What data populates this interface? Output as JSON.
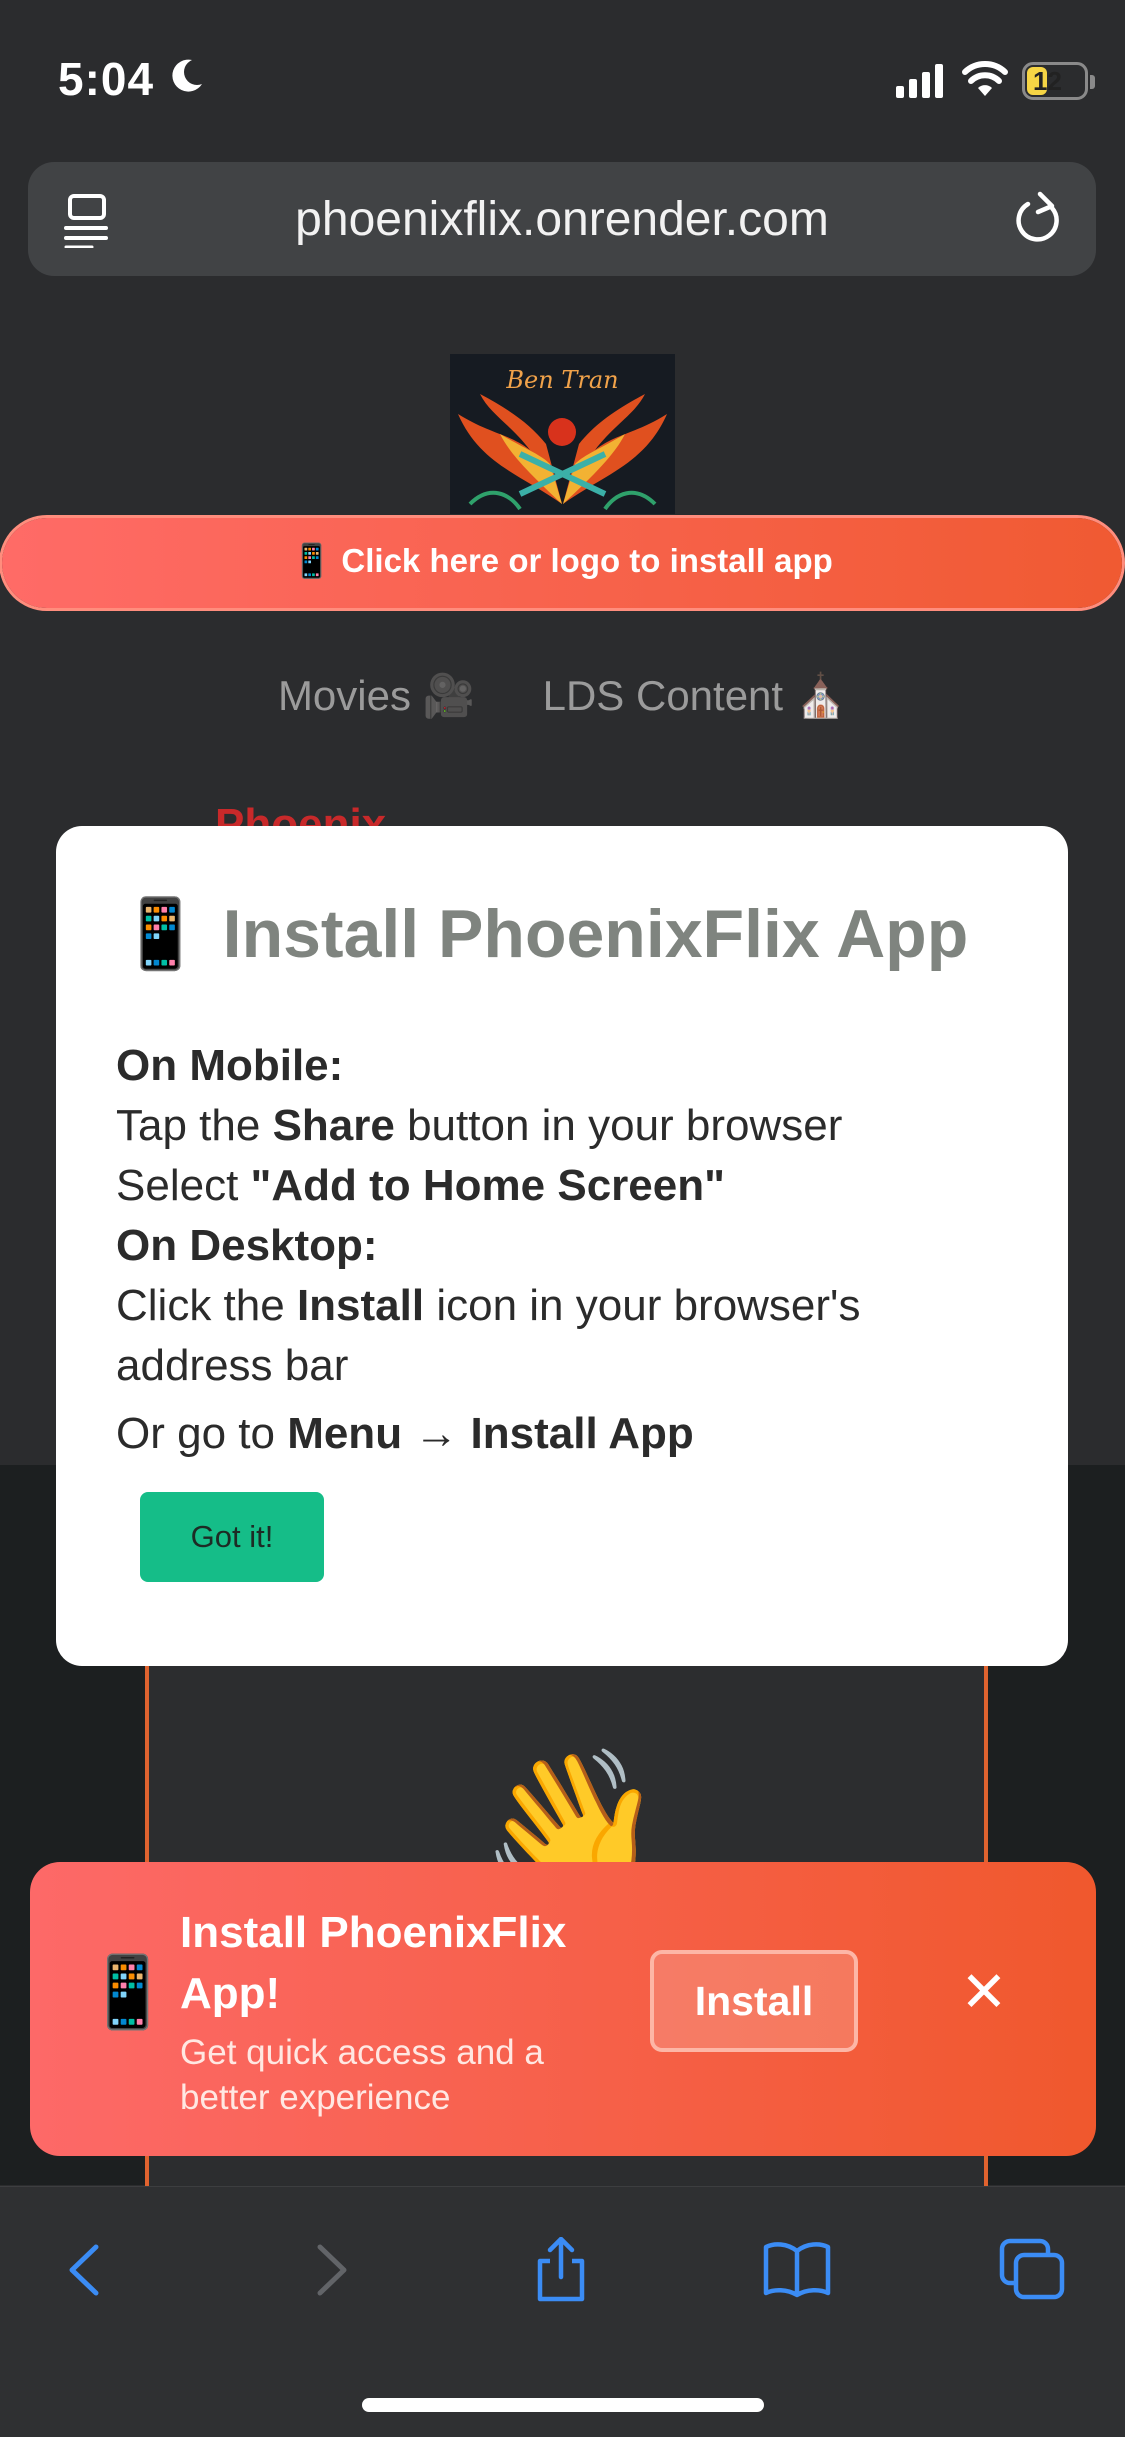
{
  "status_bar": {
    "time": "5:04",
    "battery": "12"
  },
  "browser": {
    "url": "phoenixflix.onrender.com"
  },
  "page": {
    "logo_text": "Ben Tran",
    "install_banner": "📱 Click here or logo to install app",
    "nav": {
      "movies": "Movies 🎥",
      "lds": "LDS Content ⛪"
    },
    "partial_title": "Phoenix",
    "wave_emoji": "👋"
  },
  "modal": {
    "emoji": "📱",
    "title": "Install PhoenixFlix App",
    "mobile_heading": "On Mobile:",
    "mobile_line1_pre": "Tap the ",
    "mobile_line1_bold": "Share",
    "mobile_line1_post": " button in your browser",
    "mobile_line2_pre": "Select ",
    "mobile_line2_bold": "\"Add to Home Screen\"",
    "desktop_heading": "On Desktop:",
    "desktop_line1_pre": "Click the ",
    "desktop_line1_bold": "Install",
    "desktop_line1_post": " icon in your browser's address bar",
    "or_pre": "Or go to ",
    "or_menu": "Menu",
    "or_arrow": " → ",
    "or_install": "Install App",
    "button": "Got it!"
  },
  "toast": {
    "emoji": "📱",
    "title": "Install PhoenixFlix App!",
    "subtitle": "Get quick access and a better experience",
    "install_button": "Install",
    "close": "✕"
  },
  "colors": {
    "accent": "#f05a32",
    "got_it": "#15bd88",
    "safari_blue": "#3b8cf5"
  }
}
